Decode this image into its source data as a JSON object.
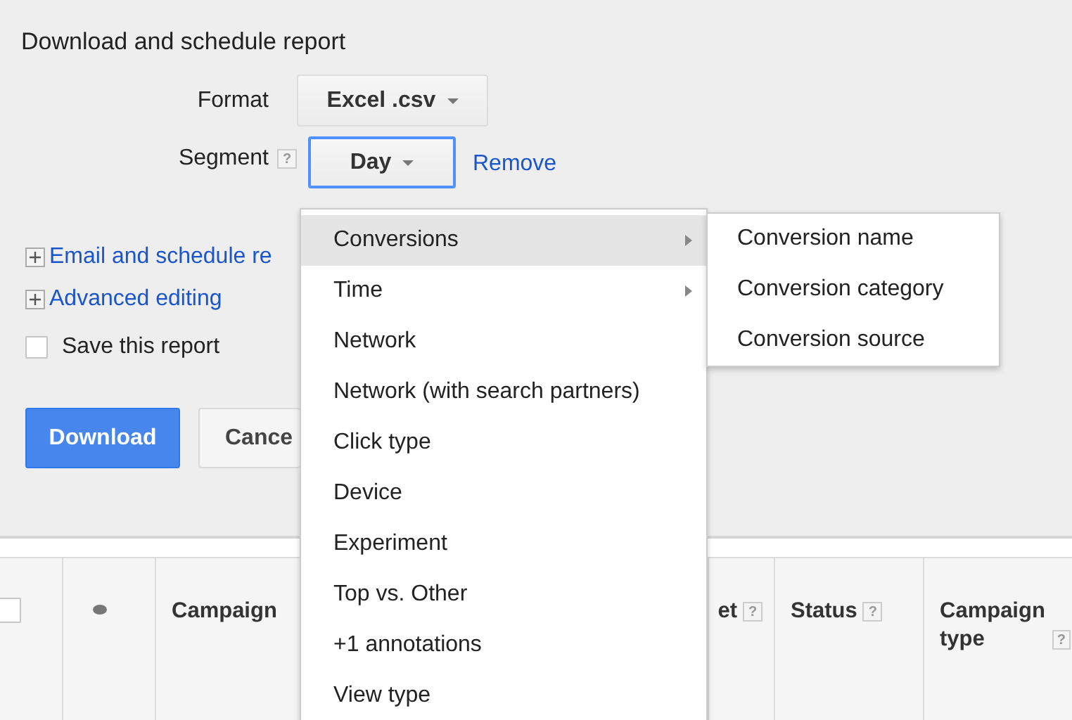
{
  "title": "Download and schedule report",
  "format": {
    "label": "Format",
    "value": "Excel .csv"
  },
  "segment": {
    "label": "Segment",
    "help": "?",
    "value": "Day",
    "focused": true,
    "remove": "Remove"
  },
  "links": [
    {
      "text": "Email and schedule re",
      "expanded": false
    },
    {
      "text": "Advanced editing",
      "expanded": false
    }
  ],
  "save_report": {
    "label": "Save this report",
    "checked": false
  },
  "buttons": [
    {
      "label": "Download",
      "kind": "primary"
    },
    {
      "label": "Cance",
      "kind": "secondary"
    }
  ],
  "table_header": [
    {
      "kind": "checkbox",
      "checked": false
    },
    {
      "kind": "dot"
    },
    {
      "kind": "text",
      "label": "Campaign"
    },
    {
      "kind": "hidden"
    },
    {
      "kind": "cut_text",
      "label": "et",
      "help": "?"
    },
    {
      "kind": "text",
      "label": "Status",
      "help": "?"
    },
    {
      "kind": "text",
      "label": "Campaign type",
      "help": "?"
    }
  ],
  "menu": [
    {
      "label": "Conversions",
      "submenu": true,
      "selected": true
    },
    {
      "label": "Time",
      "submenu": true,
      "selected": false
    },
    {
      "label": "Network",
      "submenu": false,
      "selected": false
    },
    {
      "label": "Network (with search partners)",
      "submenu": false,
      "selected": false
    },
    {
      "label": "Click type",
      "submenu": false,
      "selected": false
    },
    {
      "label": "Device",
      "submenu": false,
      "selected": false
    },
    {
      "label": "Experiment",
      "submenu": false,
      "selected": false
    },
    {
      "label": "Top vs. Other",
      "submenu": false,
      "selected": false
    },
    {
      "label": "+1 annotations",
      "submenu": false,
      "selected": false
    },
    {
      "label": "View type",
      "submenu": false,
      "selected": false
    }
  ],
  "submenu": [
    "Conversion name",
    "Conversion category",
    "Conversion source"
  ]
}
